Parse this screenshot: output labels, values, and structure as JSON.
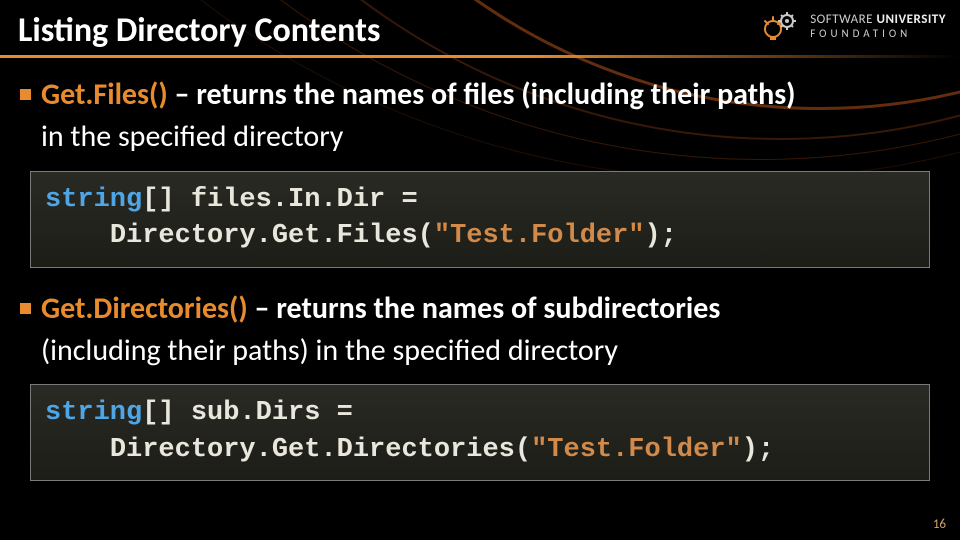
{
  "title": "Listing Directory Contents",
  "logo": {
    "line1": "SOFTWARE",
    "line2": "UNIVERSITY",
    "line3": "FOUNDATION"
  },
  "items": [
    {
      "method": "Get.Files()",
      "desc_line1": " – returns the names of files (including their paths)",
      "desc_line2": "in the specified directory",
      "code": {
        "kw": "string",
        "arr": "[] ",
        "var": "files.In.Dir",
        "eq": " =",
        "indent": "    ",
        "obj": "Directory",
        "dot": ".",
        "call": "Get.Files",
        "open": "(",
        "arg": "\"Test.Folder\"",
        "close": ");"
      }
    },
    {
      "method": "Get.Directories()",
      "desc_line1": " – returns the names of subdirectories",
      "desc_line2": "(including their paths) in the specified directory",
      "code": {
        "kw": "string",
        "arr": "[] ",
        "var": "sub.Dirs",
        "eq": " =",
        "indent": "    ",
        "obj": "Directory",
        "dot": ".",
        "call": "Get.Directories",
        "open": "(",
        "arg": "\"Test.Folder\"",
        "close": ");"
      }
    }
  ],
  "page_number": "16"
}
